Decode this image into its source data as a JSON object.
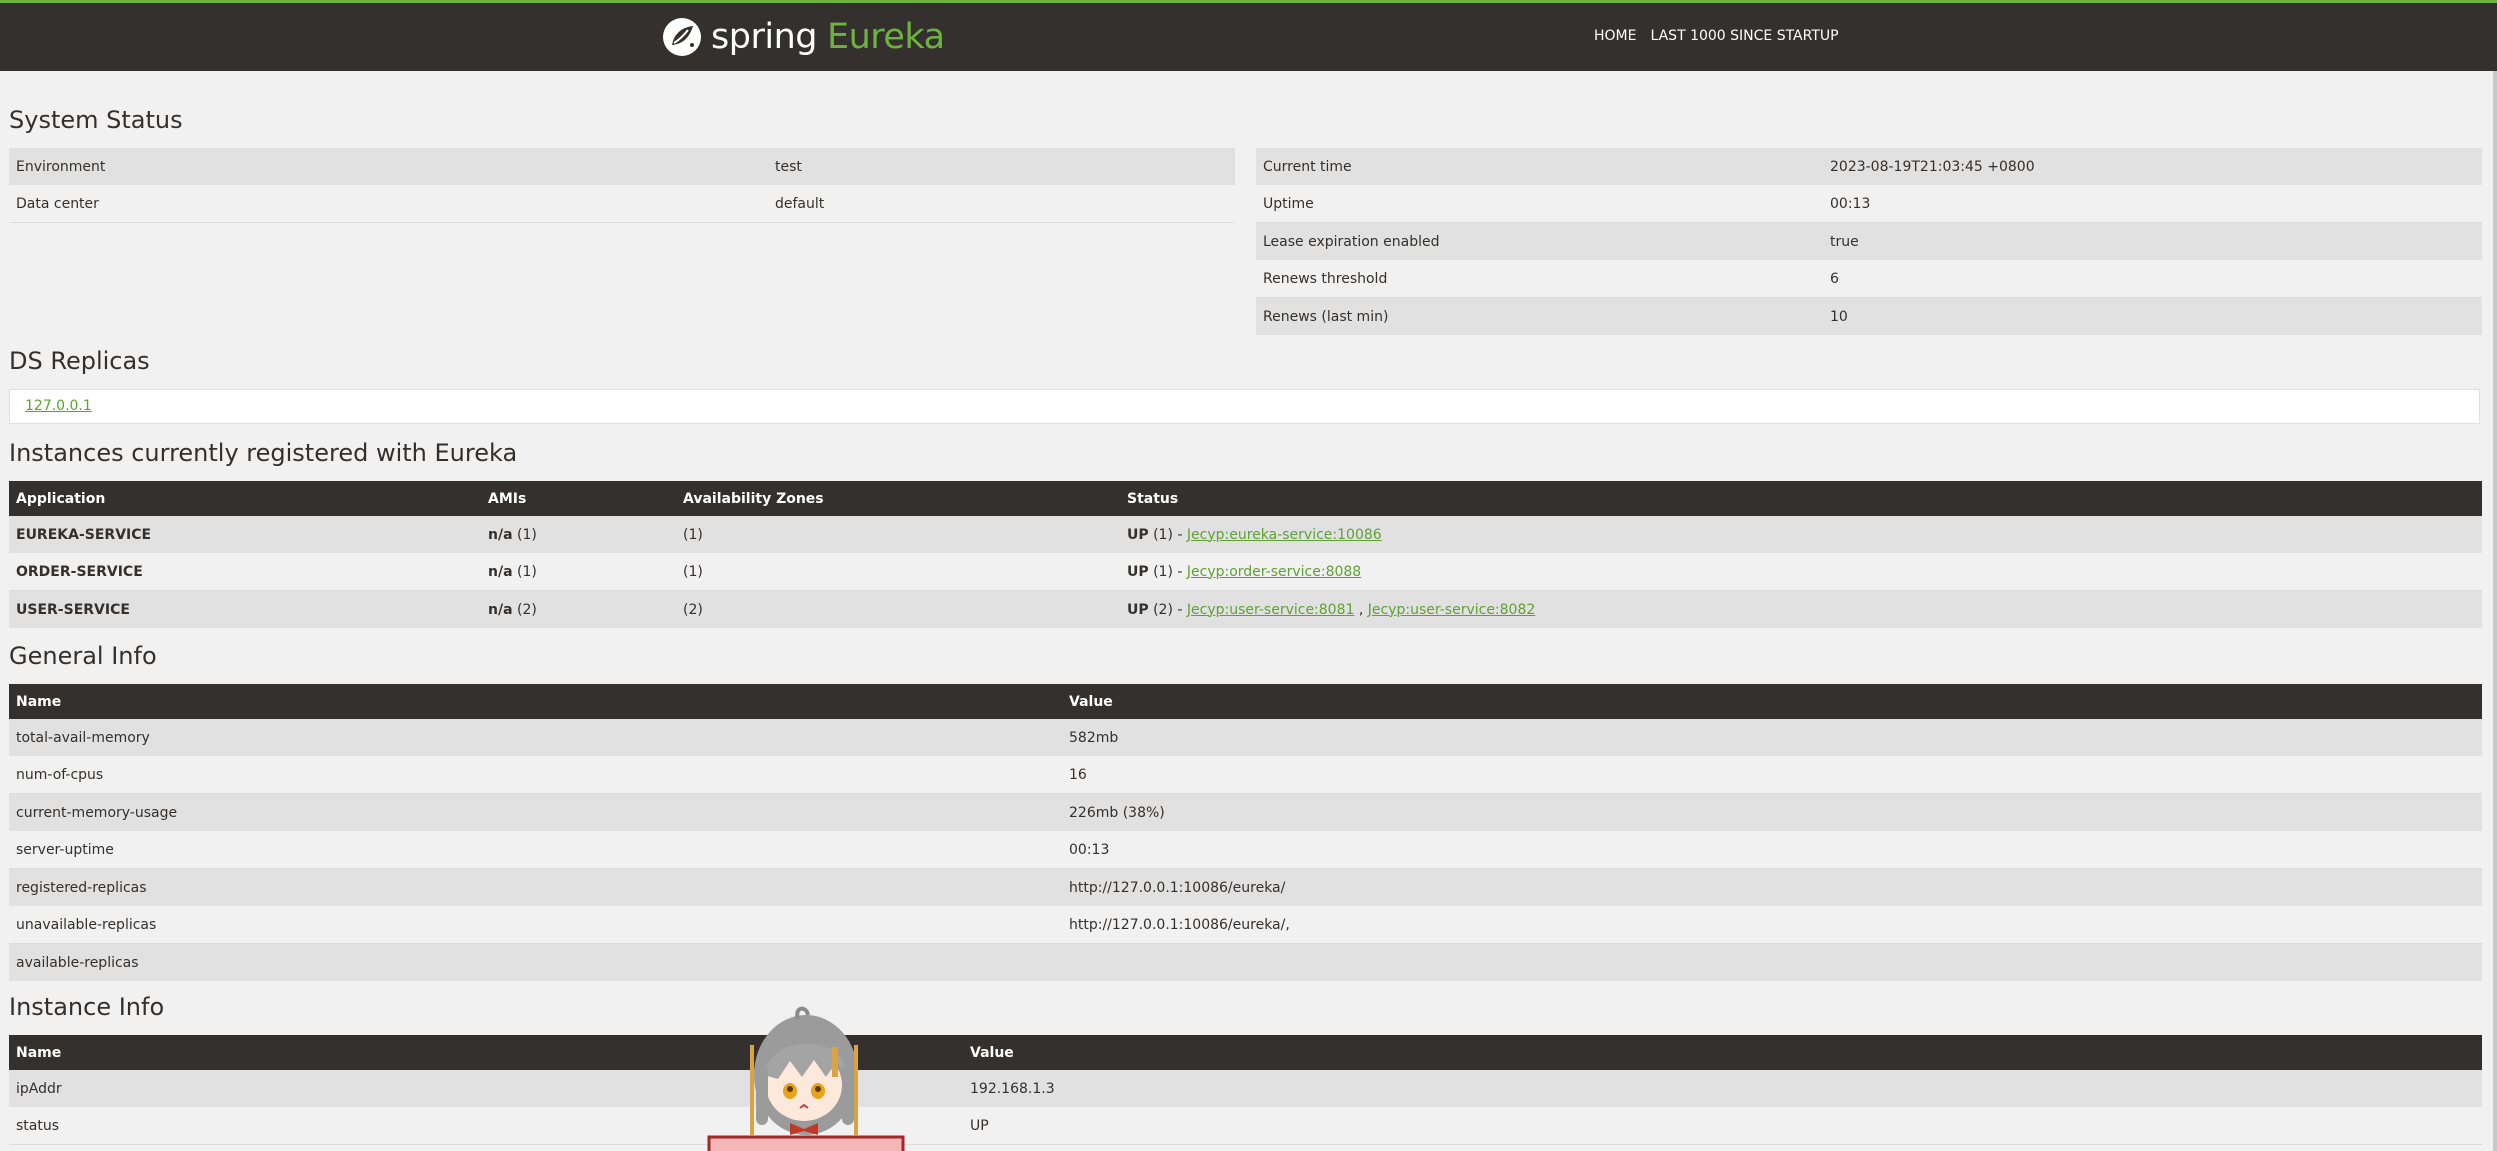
{
  "nav": {
    "brand_main": "spring",
    "brand_accent": "Eureka",
    "links": [
      "HOME",
      "LAST 1000 SINCE STARTUP"
    ]
  },
  "system_status": {
    "title": "System Status",
    "left": [
      {
        "label": "Environment",
        "value": "test"
      },
      {
        "label": "Data center",
        "value": "default"
      }
    ],
    "right": [
      {
        "label": "Current time",
        "value": "2023-08-19T21:03:45 +0800"
      },
      {
        "label": "Uptime",
        "value": "00:13"
      },
      {
        "label": "Lease expiration enabled",
        "value": "true"
      },
      {
        "label": "Renews threshold",
        "value": "6"
      },
      {
        "label": "Renews (last min)",
        "value": "10"
      }
    ]
  },
  "ds_replicas": {
    "title": "DS Replicas",
    "replica": "127.0.0.1"
  },
  "instances": {
    "title": "Instances currently registered with Eureka",
    "headers": [
      "Application",
      "AMIs",
      "Availability Zones",
      "Status"
    ],
    "rows": [
      {
        "app": "EUREKA-SERVICE",
        "ami_bold": "n/a",
        "ami_count": "(1)",
        "zones": "(1)",
        "status_bold": "UP",
        "status_count": "(1) -",
        "links": [
          "Jecyp:eureka-service:10086"
        ]
      },
      {
        "app": "ORDER-SERVICE",
        "ami_bold": "n/a",
        "ami_count": "(1)",
        "zones": "(1)",
        "status_bold": "UP",
        "status_count": "(1) -",
        "links": [
          "Jecyp:order-service:8088"
        ]
      },
      {
        "app": "USER-SERVICE",
        "ami_bold": "n/a",
        "ami_count": "(2)",
        "zones": "(2)",
        "status_bold": "UP",
        "status_count": "(2) -",
        "links": [
          "Jecyp:user-service:8081",
          "Jecyp:user-service:8082"
        ],
        "separator": ","
      }
    ]
  },
  "general_info": {
    "title": "General Info",
    "headers": [
      "Name",
      "Value"
    ],
    "rows": [
      {
        "name": "total-avail-memory",
        "value": "582mb"
      },
      {
        "name": "num-of-cpus",
        "value": "16"
      },
      {
        "name": "current-memory-usage",
        "value": "226mb (38%)"
      },
      {
        "name": "server-uptime",
        "value": "00:13"
      },
      {
        "name": "registered-replicas",
        "value": "http://127.0.0.1:10086/eureka/"
      },
      {
        "name": "unavailable-replicas",
        "value": "http://127.0.0.1:10086/eureka/,"
      },
      {
        "name": "available-replicas",
        "value": ""
      }
    ]
  },
  "instance_info": {
    "title": "Instance Info",
    "headers": [
      "Name",
      "Value"
    ],
    "rows": [
      {
        "name": "ipAddr",
        "value": "192.168.1.3"
      },
      {
        "name": "status",
        "value": "UP"
      }
    ]
  },
  "colors": {
    "accent": "#6db33f",
    "dark": "#34302d",
    "link": "#5fa134"
  }
}
